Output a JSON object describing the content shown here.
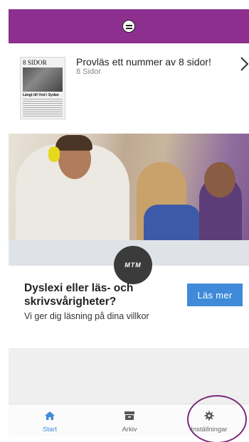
{
  "header": {
    "logo_icon": "mtm-round-logo-icon",
    "color": "#8d2f8f"
  },
  "promo": {
    "thumbnail": {
      "masthead": "8 SIDOR",
      "headline": "Längt till Vnd i Sydan"
    },
    "title": "Provläs ett nummer av 8 sidor!",
    "subtitle": "8 Sidor",
    "chevron_icon": "chevron-right-icon"
  },
  "banner": {
    "badge_text": "MTM",
    "heading": "Dyslexi eller läs- och skrivsvårigheter?",
    "text": "Vi ger dig läsning på dina villkor",
    "button_label": "Läs mer",
    "button_color": "#3f8ad9"
  },
  "tabs": [
    {
      "label": "Start",
      "icon": "home-icon",
      "active": true
    },
    {
      "label": "Arkiv",
      "icon": "archive-icon",
      "active": false
    },
    {
      "label": "Inställningar",
      "icon": "gear-icon",
      "active": false
    }
  ],
  "accent_color": "#3f8ad9"
}
